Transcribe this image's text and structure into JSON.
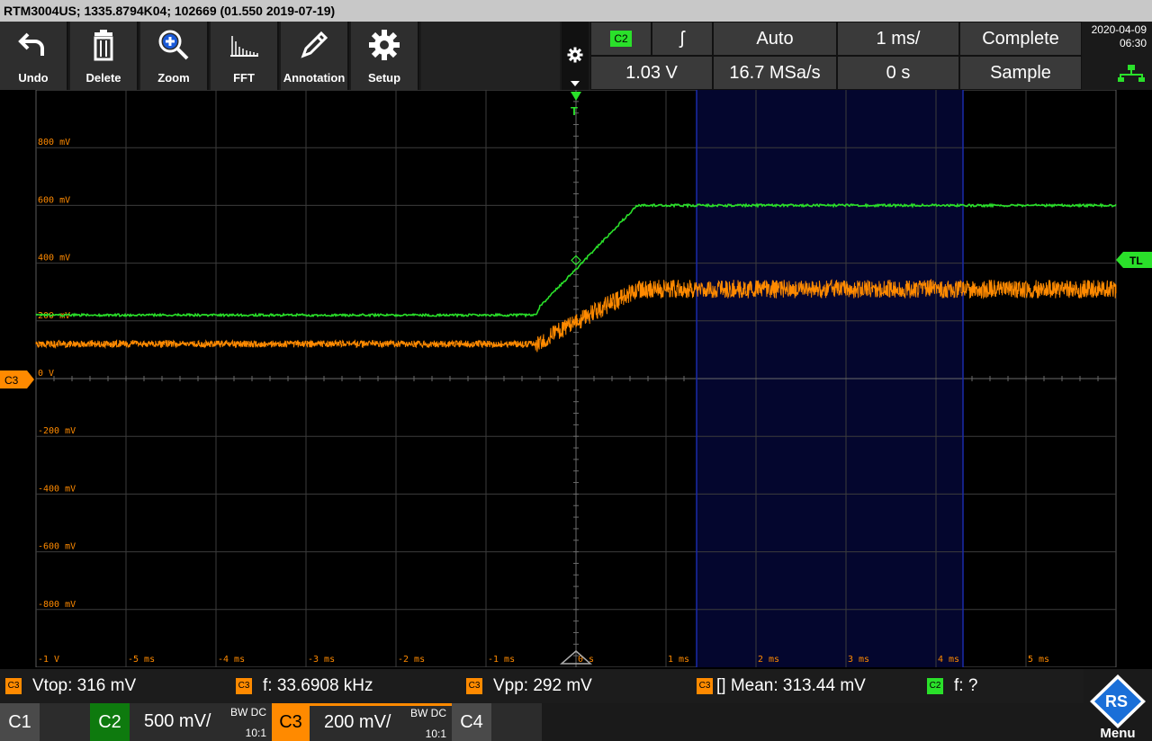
{
  "title_bar": {
    "text": "RTM3004US; 1335.8794K04; 102669 (01.550 2019-07-19)"
  },
  "toolbar": {
    "buttons": [
      {
        "label": "Undo",
        "icon": "undo-arrow-icon"
      },
      {
        "label": "Delete",
        "icon": "trash-icon"
      },
      {
        "label": "Zoom",
        "icon": "magnifier-plus-icon"
      },
      {
        "label": "FFT",
        "icon": "fft-spectrum-icon"
      },
      {
        "label": "Annotation",
        "icon": "pencil-icon"
      },
      {
        "label": "Setup",
        "icon": "gear-icon"
      }
    ]
  },
  "trigger_panel": {
    "source": "C2",
    "slope_symbol": "ʃ",
    "mode": "Auto",
    "timebase": "1 ms/",
    "acq_state": "Complete",
    "level": "1.03 V",
    "sample_rate": "16.7 MSa/s",
    "position": "0 s",
    "acq_mode": "Sample"
  },
  "datetime": {
    "date": "2020-04-09",
    "time": "06:30"
  },
  "colors": {
    "ch2": "#2ae02a",
    "ch3": "#ff8a00",
    "cursor": "#1a2aa8",
    "cursor_region": "#04062e"
  },
  "plot": {
    "y_labels": [
      "800 mV",
      "600 mV",
      "400 mV",
      "200 mV",
      "0 V",
      "-200 mV",
      "-400 mV",
      "-600 mV",
      "-800 mV",
      "-1 V"
    ],
    "x_labels": [
      "-5 ms",
      "-4 ms",
      "-3 ms",
      "-2 ms",
      "-1 ms",
      "0 s",
      "1 ms",
      "2 ms",
      "3 ms",
      "4 ms",
      "5 ms"
    ],
    "ch3_marker": "C3",
    "trigger_level_marker": "TL",
    "trigger_marker": "T"
  },
  "measurements": [
    {
      "source": "C3",
      "text": "Vtop: 316 mV"
    },
    {
      "source": "C3",
      "text": "f: 33.6908 kHz"
    },
    {
      "source": "C3",
      "text": "Vpp: 292 mV"
    },
    {
      "source": "C3",
      "text": "[] Mean: 313.44 mV"
    },
    {
      "source": "C2",
      "text": "f: ?"
    }
  ],
  "channels": {
    "c1": {
      "label": "C1"
    },
    "c2": {
      "label": "C2",
      "scale": "500 mV/",
      "bw": "BW DC",
      "probe": "10:1"
    },
    "c3": {
      "label": "C3",
      "scale": "200 mV/",
      "bw": "BW DC",
      "probe": "10:1"
    },
    "c4": {
      "label": "C4"
    }
  },
  "menu": {
    "label": "Menu",
    "logo_text": "RS"
  }
}
